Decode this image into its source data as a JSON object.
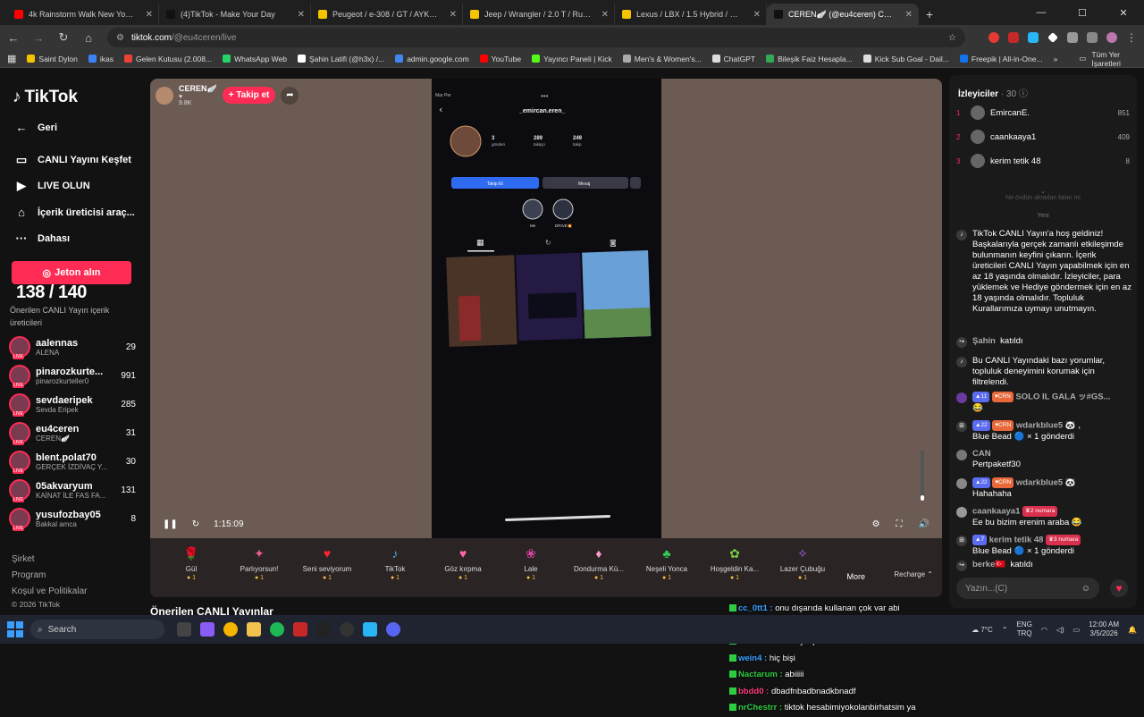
{
  "browser": {
    "tabs": [
      {
        "title": "4k Rainstorm Walk New York City",
        "color": "#ff0000",
        "active": false
      },
      {
        "title": "(4)TikTok - Make Your Day",
        "color": "#111111",
        "active": false
      },
      {
        "title": "Peugeot / e-308 / GT / AYKAN",
        "color": "#f5c400",
        "active": false
      },
      {
        "title": "Jeep / Wrangler / 2.0 T / Rubicon",
        "color": "#f5c400",
        "active": false
      },
      {
        "title": "Lexus / LBX / 1.5 Hybrid / Relax",
        "color": "#f5c400",
        "active": false
      },
      {
        "title": "CEREN🪽 (@eu4ceren) CANLI",
        "color": "#111111",
        "active": true
      }
    ],
    "new_tab": "+",
    "url_host": "tiktok.com",
    "url_path": "/@eu4ceren/live",
    "bookmarks": [
      {
        "label": "Saint Dylon",
        "color": "#f5c400"
      },
      {
        "label": "ikas",
        "color": "#3b82f6"
      },
      {
        "label": "Gelen Kutusu (2.008...",
        "color": "#ea4335"
      },
      {
        "label": "WhatsApp Web",
        "color": "#25d366"
      },
      {
        "label": "Şahin Latifi (@h3x) /...",
        "color": "#ffffff"
      },
      {
        "label": "admin.google.com",
        "color": "#4285f4"
      },
      {
        "label": "YouTube",
        "color": "#ff0000"
      },
      {
        "label": "Yayıncı Paneli | Kick",
        "color": "#53fc18"
      },
      {
        "label": "Men's & Women's...",
        "color": "#aaaaaa"
      },
      {
        "label": "ChatGPT",
        "color": "#dddddd"
      },
      {
        "label": "Bileşik Faiz Hesapla...",
        "color": "#34a853"
      },
      {
        "label": "Kick Sub Goal - Dail...",
        "color": "#dddddd"
      },
      {
        "label": "Freepik | All-in-One...",
        "color": "#1273eb"
      }
    ],
    "bookmarks_more": "»",
    "all_bookmarks": "Tüm Yer İşaretleri"
  },
  "sidebar": {
    "logo": "TikTok",
    "nav": [
      {
        "icon": "back-arrow-icon",
        "glyph": "←",
        "label": "Geri"
      },
      {
        "icon": "live-explore-icon",
        "glyph": "▭",
        "label": "CANLI Yayını Keşfet"
      },
      {
        "icon": "camera-icon",
        "glyph": "▶",
        "label": "LIVE OLUN"
      },
      {
        "icon": "creator-tools-icon",
        "glyph": "⌂",
        "label": "İçerik üreticisi araç..."
      },
      {
        "icon": "more-dots-icon",
        "glyph": "···",
        "label": "Dahası"
      }
    ],
    "jeton_button": "Jeton alın",
    "counter": "138 / 140",
    "recommended_title": "Önerilen CANLI Yayın içerik üreticileri",
    "creators": [
      {
        "name": "aalennas",
        "sub": "ALENA",
        "count": "29"
      },
      {
        "name": "pinarozkurte...",
        "sub": "pinarozkurteller0",
        "count": "991"
      },
      {
        "name": "sevdaeripek",
        "sub": "Sevda Eripek",
        "count": "285"
      },
      {
        "name": "eu4ceren",
        "sub": "CEREN🪽",
        "count": "31"
      },
      {
        "name": "blent.polat70",
        "sub": "GERÇEK İZDİVAÇ Y...",
        "count": "30"
      },
      {
        "name": "05akvaryum",
        "sub": "KAİNAT İLE FAS FA...",
        "count": "131"
      },
      {
        "name": "yusufozbay05",
        "sub": "Bakkal amca",
        "count": "8"
      }
    ],
    "footer_links": [
      "Şirket",
      "Program",
      "Koşul ve Politikalar"
    ],
    "copyright": "© 2026 TikTok"
  },
  "player": {
    "host_name": "CEREN🪽",
    "host_likes": "9.8K",
    "follow_button": "+ Takip et",
    "time": "1:15:09",
    "volume_level": 0.1,
    "gifts": [
      {
        "name": "Gül",
        "cost": "1",
        "glyph": "🌹",
        "color": "#d22"
      },
      {
        "name": "Parlıyorsun!",
        "cost": "1",
        "glyph": "✦",
        "color": "#e85a8f"
      },
      {
        "name": "Seni seviyorum",
        "cost": "1",
        "glyph": "♥",
        "color": "#f23"
      },
      {
        "name": "TikTok",
        "cost": "1",
        "glyph": "♪",
        "color": "#4ad"
      },
      {
        "name": "Göz kırpma",
        "cost": "1",
        "glyph": "♥",
        "color": "#f6a"
      },
      {
        "name": "Lale",
        "cost": "1",
        "glyph": "❀",
        "color": "#d4a"
      },
      {
        "name": "Dondurma Kü...",
        "cost": "1",
        "glyph": "♦",
        "color": "#f9c"
      },
      {
        "name": "Neşeli Yonca",
        "cost": "1",
        "glyph": "♣",
        "color": "#3c5"
      },
      {
        "name": "Hoşgeldin Ka...",
        "cost": "1",
        "glyph": "✿",
        "color": "#7c4"
      },
      {
        "name": "Lazer Çubuğu",
        "cost": "1",
        "glyph": "✧",
        "color": "#a6f"
      }
    ],
    "more_label": "More",
    "recharge_label": "Recharge ⌃"
  },
  "phone_screen": {
    "username": "_emircan.eren_",
    "posts": "3",
    "posts_label": "gönderi",
    "followers": "289",
    "followers_label": "takipçi",
    "following": "249",
    "following_label": "takip",
    "follow_btn": "Takip Et",
    "message_btn": "Mesaj",
    "highlights": [
      "Me",
      "DRIVE💥"
    ]
  },
  "recommended_live_title": "Önerilen CANLI Yayınlar",
  "right_panel": {
    "viewers_label": "İzleyiciler",
    "viewers_count": "· 30",
    "top_viewers": [
      {
        "rank": "1",
        "name": "EmircanE.",
        "score": "851"
      },
      {
        "rank": "2",
        "name": "caankaaya1",
        "score": "409"
      },
      {
        "rank": "3",
        "name": "kerim tetik 48",
        "score": "8"
      }
    ],
    "faded_text": "Ne övdün akradan falan mi",
    "new_label": "Yeni",
    "welcome": "TikTok CANLI Yayın'a hoş geldiniz! Başkalarıyla gerçek zamanlı etkileşimde bulunmanın keyfini çıkarın. İçerik üreticileri CANLI Yayın yapabilmek için en az 18 yaşında olmalıdır. İzleyiciler, para yüklemek ve Hediye göndermek için en az 18 yaşında olmalıdır. Topluluk Kurallarımıza uymayı unutmayın.",
    "joined1_user": "Şahin",
    "joined1_text": "katıldı",
    "filter_note": "Bu CANLI Yayındaki bazı yorumlar, topluluk deneyimini korumak için filtrelendi.",
    "msg1_lvl": "11",
    "msg1_crn": "CRN",
    "msg1_user": "SOLO IL GALA ッ#GS...",
    "msg1_text": "😂",
    "msg2_lvl": "22",
    "msg2_crn": "CRN",
    "msg2_user": "wdarkblue5 🐼 ,",
    "msg2_text": "Blue Bead 🔵 × 1 gönderdi",
    "msg3_user": "CAN",
    "msg3_text": "Pertpaketf30",
    "msg4_lvl": "22",
    "msg4_crn": "CRN",
    "msg4_user": "wdarkblue5 🐼",
    "msg4_text": "Hahahaha",
    "msg5_user": "caankaaya1",
    "msg5_badge": "2 numara",
    "msg5_text": "Ee bu bizim erenim araba 😂",
    "msg6_lvl": "7",
    "msg6_user": "kerim tetik 48",
    "msg6_badge": "3 numara",
    "msg6_text": "Blue Bead 🔵 × 1 gönderdi",
    "joined2_user": "berke🇹🇷",
    "joined2_text": "katıldı",
    "chat_placeholder": "Yazın...(C)"
  },
  "overlay_chat": [
    {
      "user": "cc_0tt1 :",
      "text": "onu dışarıda kullanan çok var abi",
      "ucolor": "#3aa0ff"
    },
    {
      "user": "",
      "text": "daha niş bi şeyler istiyorsan alma direkt",
      "ucolor": "#ffffff"
    },
    {
      "user": "Theworld :",
      "text": "suraya şahinlatifi linki",
      "ucolor": "#ff3b7f"
    },
    {
      "user": "wein4 :",
      "text": "hiç bişi",
      "ucolor": "#3aa0ff"
    },
    {
      "user": "Nactarum :",
      "text": "abiiiii",
      "ucolor": "#2ecc40"
    },
    {
      "user": "bbdd0 :",
      "text": "dbadfnbadbnadkbnadf",
      "ucolor": "#ff3b7f"
    },
    {
      "user": "nrChestrr :",
      "text": "tiktok hesabimiyokolanbirhatsim ya",
      "ucolor": "#2ecc40"
    }
  ],
  "taskbar": {
    "search": "Search",
    "weather": "7°C",
    "lang1": "ENG",
    "lang2": "TRQ",
    "time": "12:00 AM",
    "date": "3/5/2026"
  }
}
